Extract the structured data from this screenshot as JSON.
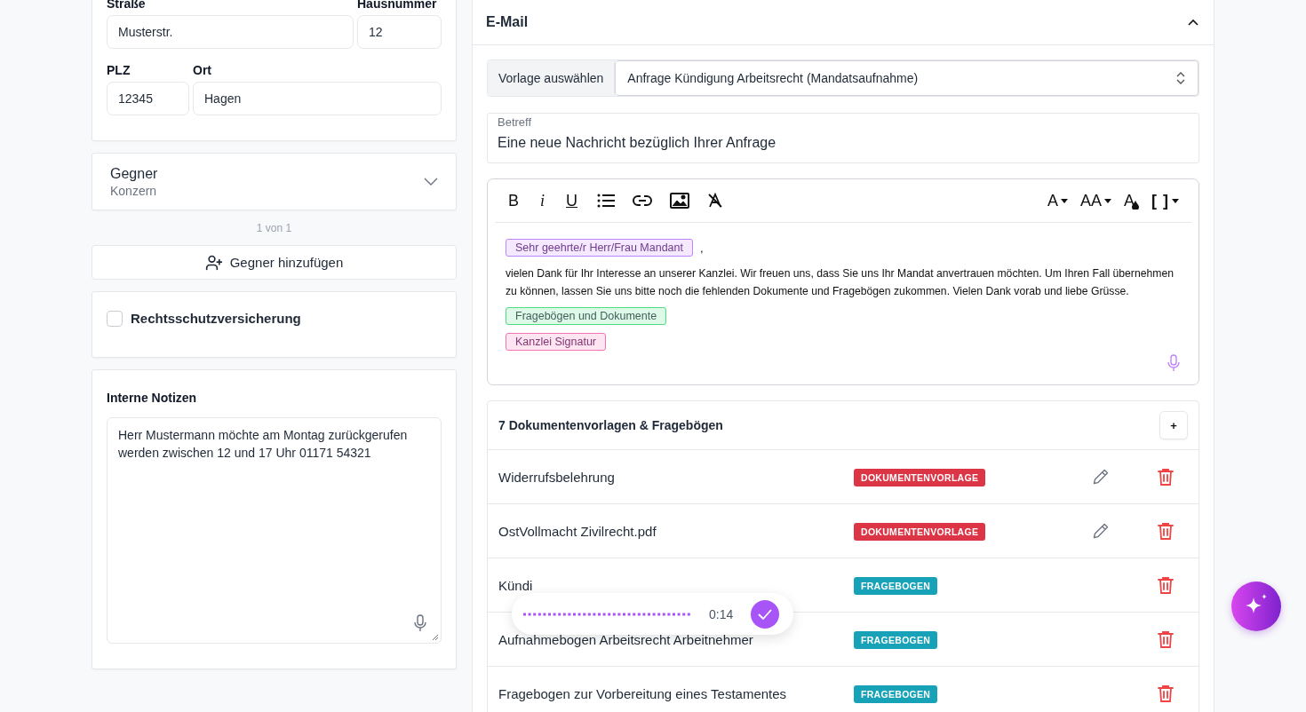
{
  "address": {
    "fields": [
      {
        "label": "Straße",
        "value": "Musterstr."
      },
      {
        "label": "Hausnummer",
        "value": "12"
      },
      {
        "label": "PLZ",
        "value": "12345"
      },
      {
        "label": "Ort",
        "value": "Hagen"
      }
    ]
  },
  "opponent": {
    "title": "Gegner",
    "subtitle": "Konzern",
    "expanded": false,
    "pager": "1 von 1",
    "add_button": "Gegner hinzufügen"
  },
  "insurance": {
    "label": "Rechtsschutzversicherung",
    "checked": false
  },
  "notes": {
    "title": "Interne Notizen",
    "value": "Herr Mustermann möchte am Montag zurückgerufen werden zwischen 12 und 17 Uhr 01171 54321"
  },
  "email": {
    "title": "E-Mail",
    "expanded": true,
    "template_label": "Vorlage auswählen",
    "template_value": "Anfrage Kündigung Arbeitsrecht (Mandatsaufnahme)",
    "subject_label": "Betreff",
    "subject_value": "Eine neue Nachricht bezüglich Ihrer Anfrage",
    "toolbar": [
      {
        "kind": "bold",
        "label": "B"
      },
      {
        "kind": "italic",
        "label": "i"
      },
      {
        "kind": "underline",
        "label": "U"
      },
      {
        "kind": "list"
      },
      {
        "kind": "link"
      },
      {
        "kind": "image"
      },
      {
        "kind": "clear"
      },
      {
        "kind": "font",
        "label": "A"
      },
      {
        "kind": "size",
        "label": "AA"
      },
      {
        "kind": "color",
        "label": "A"
      },
      {
        "kind": "brackets",
        "label": "[ ]"
      }
    ],
    "body": [
      {
        "kind": "tag",
        "color": "#c084fc",
        "text": "Sehr geehrte/r Herr/Frau Mandant",
        "suffix": ","
      },
      {
        "kind": "paragraph",
        "text": "vielen Dank für Ihr Interesse an unserer Kanzlei. Wir freuen uns, dass Sie uns Ihr Mandat anvertrauen möchten. Um Ihren Fall übernehmen zu können, lassen Sie uns bitte noch die fehlenden Dokumente und Fragebögen zukommen. Vielen Dank vorab und liebe Grüsse."
      },
      {
        "kind": "tag",
        "color": "#4ade80",
        "text": "Fragebögen und Dokumente"
      },
      {
        "kind": "tag",
        "color": "#f472b6",
        "text": "Kanzlei Signatur"
      }
    ]
  },
  "documents": {
    "title": "7 Dokumentenvorlagen & Fragebögen",
    "add_button": "+",
    "rows": [
      {
        "name": "Widerrufsbelehrung",
        "type": "DOKUMENTENVORLAGE",
        "color": "#dc3545",
        "editable": true
      },
      {
        "name": "OstVollmacht Zivilrecht.pdf",
        "type": "DOKUMENTENVORLAGE",
        "color": "#dc3545",
        "editable": true
      },
      {
        "name": "Kündi",
        "type": "FRAGEBOGEN",
        "color": "#17a2b8",
        "editable": false
      },
      {
        "name": "Aufnahmebogen Arbeitsrecht Arbeitnehmer",
        "type": "FRAGEBOGEN",
        "color": "#17a2b8",
        "editable": false
      },
      {
        "name": "Fragebogen zur Vorbereitung eines Testamentes",
        "type": "FRAGEBOGEN",
        "color": "#17a2b8",
        "editable": false
      }
    ]
  },
  "recorder": {
    "time": "0:14"
  }
}
